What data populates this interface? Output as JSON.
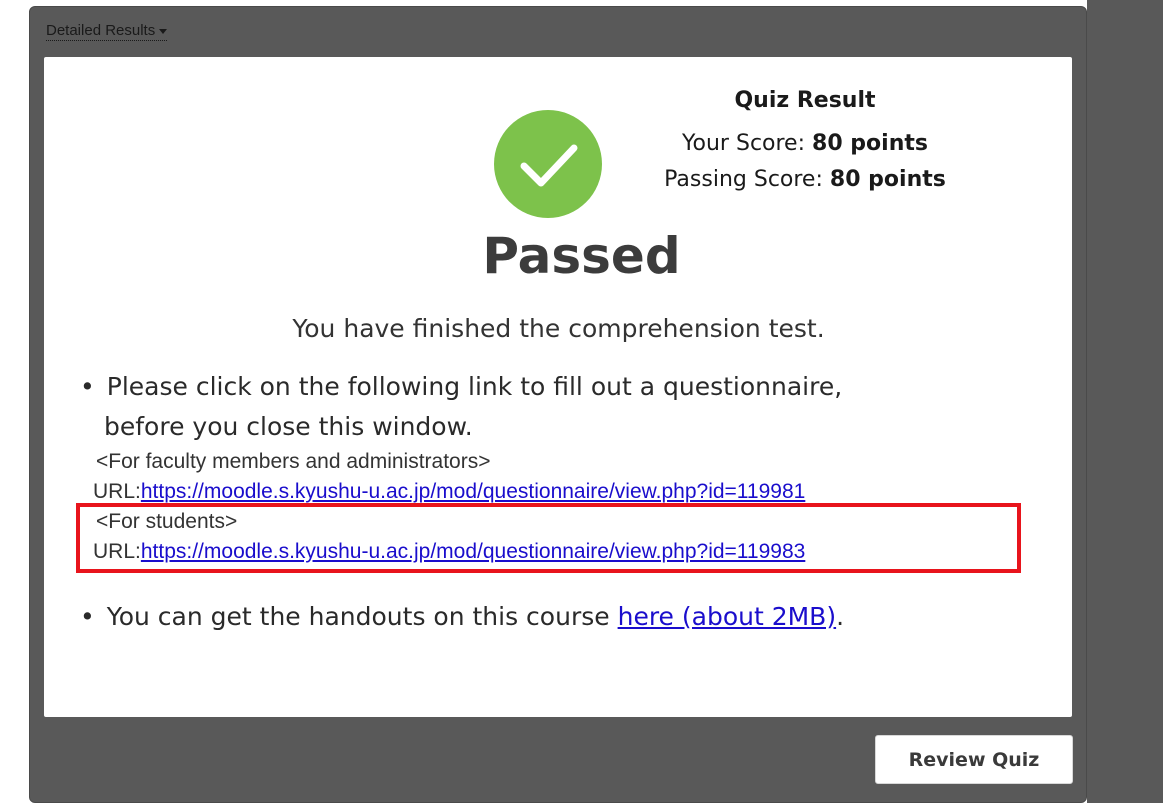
{
  "header": {
    "detailed_results_label": "Detailed Results"
  },
  "result": {
    "title": "Quiz Result",
    "your_score_label": "Your Score:",
    "your_score_value": "80 points",
    "passing_score_label": "Passing Score:",
    "passing_score_value": "80 points",
    "status": "Passed"
  },
  "content": {
    "finished_message": "You have finished the comprehension test.",
    "questionnaire_line1": "Please click on the following link to fill out a questionnaire,",
    "questionnaire_line2": "before you close this window.",
    "faculty_heading": "<For faculty members and administrators>",
    "faculty_url_label": "URL:",
    "faculty_url": "https://moodle.s.kyushu-u.ac.jp/mod/questionnaire/view.php?id=119981",
    "students_heading": "<For students>",
    "students_url_label": "URL:",
    "students_url": "https://moodle.s.kyushu-u.ac.jp/mod/questionnaire/view.php?id=119983",
    "handouts_prefix": "You can get the handouts on this course",
    "handouts_link": "here (about 2MB)",
    "handouts_suffix": "."
  },
  "footer": {
    "review_button_label": "Review Quiz"
  },
  "colors": {
    "check_green": "#7dc24b",
    "highlight_red": "#e8141c",
    "link_blue": "#1a0dcc"
  }
}
